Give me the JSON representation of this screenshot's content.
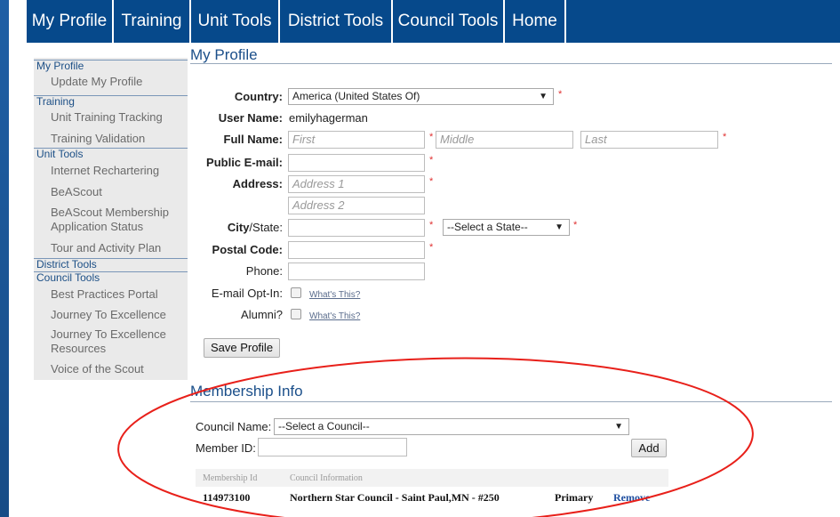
{
  "topnav": {
    "tabs": [
      {
        "label": "My Profile"
      },
      {
        "label": "Training"
      },
      {
        "label": "Unit Tools"
      },
      {
        "label": "District Tools"
      },
      {
        "label": "Council Tools"
      },
      {
        "label": "Home"
      }
    ]
  },
  "sidebar": {
    "sections": [
      {
        "label": "My Profile",
        "items": [
          "Update My Profile"
        ]
      },
      {
        "label": "Training",
        "items": [
          "Unit Training Tracking",
          "Training Validation"
        ]
      },
      {
        "label": "Unit Tools",
        "items": [
          "Internet Rechartering",
          "BeAScout",
          "BeAScout Membership Application Status",
          "Tour and Activity Plan"
        ]
      },
      {
        "label": "District Tools",
        "items": []
      },
      {
        "label": "Council Tools",
        "items": [
          "Best Practices Portal",
          "Journey To Excellence",
          "Journey To Excellence Resources",
          "Voice of the Scout"
        ]
      }
    ]
  },
  "profile": {
    "title": "My Profile",
    "country_label": "Country:",
    "country_value": "America (United States Of)",
    "username_label": "User Name:",
    "username_value": "emilyhagerman",
    "fullname_label": "Full Name:",
    "first_placeholder": "First",
    "middle_placeholder": "Middle",
    "last_placeholder": "Last",
    "email_label": "Public E-mail:",
    "address_label": "Address:",
    "address1_placeholder": "Address 1",
    "address2_placeholder": "Address 2",
    "city_label_city": "City",
    "city_label_state": "/State:",
    "state_value": "--Select a State--",
    "postal_label": "Postal Code:",
    "phone_label": "Phone:",
    "optin_label": "E-mail Opt-In:",
    "alumni_label": "Alumni?",
    "whats_this": "What's This?",
    "required_mark": "*",
    "save_label": "Save Profile"
  },
  "membership": {
    "title": "Membership Info",
    "council_label": "Council Name:",
    "council_value": "--Select a Council--",
    "memberid_label": "Member ID:",
    "add_label": "Add",
    "columns": [
      "Membership Id",
      "Council Information"
    ],
    "rows": [
      {
        "id": "114973100",
        "council": "Northern Star Council - Saint Paul,MN - #250",
        "status": "Primary",
        "action": "Remove"
      }
    ]
  },
  "colors": {
    "nav_bg": "#06498b",
    "accent": "#1b4f8a",
    "required": "#e03030",
    "annotation": "#e8201a"
  }
}
